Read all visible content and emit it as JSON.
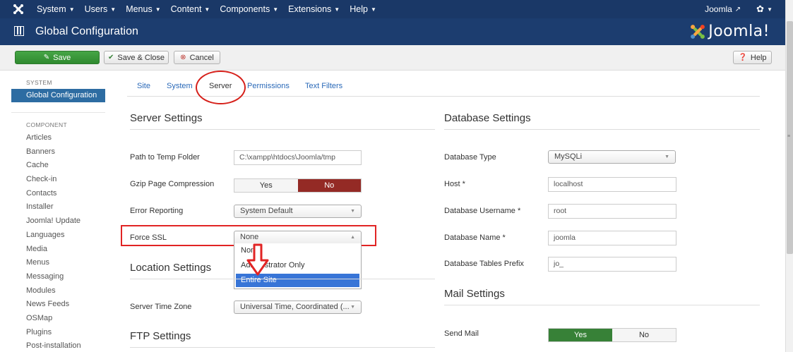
{
  "topnav": {
    "menu": [
      "System",
      "Users",
      "Menus",
      "Content",
      "Components",
      "Extensions",
      "Help"
    ],
    "right_label": "Joomla"
  },
  "header": {
    "title": "Global Configuration",
    "brand": "Joomla!"
  },
  "toolbar": {
    "save": "Save",
    "save_close": "Save & Close",
    "cancel": "Cancel",
    "help": "Help"
  },
  "sidebar": {
    "system_heading": "SYSTEM",
    "active_item": "Global Configuration",
    "component_heading": "COMPONENT",
    "items": [
      "Articles",
      "Banners",
      "Cache",
      "Check-in",
      "Contacts",
      "Installer",
      "Joomla! Update",
      "Languages",
      "Media",
      "Menus",
      "Messaging",
      "Modules",
      "News Feeds",
      "OSMap",
      "Plugins",
      "Post-installation"
    ]
  },
  "tabs": [
    "Site",
    "System",
    "Server",
    "Permissions",
    "Text Filters"
  ],
  "server": {
    "title": "Server Settings",
    "temp_label": "Path to Temp Folder",
    "temp_value": "C:\\xampp\\htdocs\\Joomla/tmp",
    "gzip_label": "Gzip Page Compression",
    "gzip_yes": "Yes",
    "gzip_no": "No",
    "error_label": "Error Reporting",
    "error_value": "System Default",
    "ssl_label": "Force SSL",
    "ssl_value": "None",
    "ssl_options": [
      "None",
      "Administrator Only",
      "Entire Site"
    ]
  },
  "location": {
    "title": "Location Settings",
    "tz_label": "Server Time Zone",
    "tz_value": "Universal Time, Coordinated (..."
  },
  "ftp": {
    "title": "FTP Settings"
  },
  "database": {
    "title": "Database Settings",
    "type_label": "Database Type",
    "type_value": "MySQLi",
    "host_label": "Host *",
    "host_value": "localhost",
    "user_label": "Database Username *",
    "user_value": "root",
    "name_label": "Database Name *",
    "name_value": "joomla",
    "prefix_label": "Database Tables Prefix",
    "prefix_value": "jo_"
  },
  "mail": {
    "title": "Mail Settings",
    "send_label": "Send Mail",
    "send_yes": "Yes",
    "send_no": "No"
  },
  "colors": {
    "nav_bg": "#1a3867",
    "header_bg": "#1c3d6f",
    "save_green": "#46a546",
    "no_red": "#942a25",
    "highlight_blue": "#3875d7",
    "annotation_red": "#e12424"
  }
}
